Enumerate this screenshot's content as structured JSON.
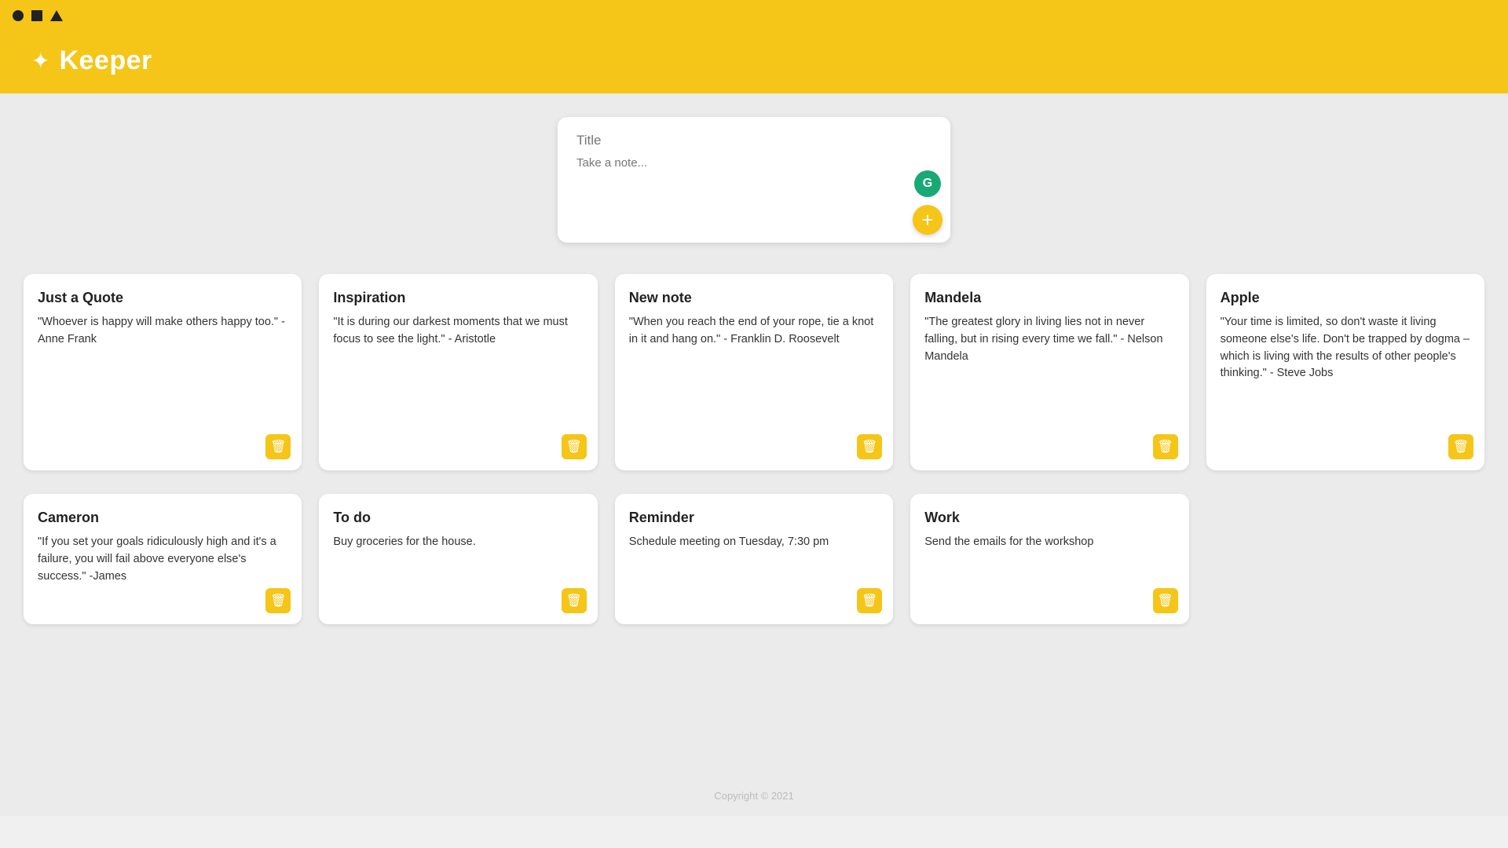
{
  "titlebar": {
    "shapes": [
      "circle",
      "square",
      "triangle"
    ]
  },
  "header": {
    "logo_symbol": "✦",
    "title": "Keeper"
  },
  "note_input": {
    "title_placeholder": "Title",
    "body_placeholder": "Take a note...",
    "grammarly_label": "G",
    "add_button_label": "+"
  },
  "notes_row1": [
    {
      "title": "Just a Quote",
      "body": "\"Whoever is happy will make others happy too.\" -Anne Frank"
    },
    {
      "title": "Inspiration",
      "body": "\"It is during our darkest moments that we must focus to see the light.\" - Aristotle"
    },
    {
      "title": "New note",
      "body": "\"When you reach the end of your rope, tie a knot in it and hang on.\" - Franklin D. Roosevelt"
    },
    {
      "title": "Mandela",
      "body": "\"The greatest glory in living lies not in never falling, but in rising every time we fall.\" - Nelson Mandela"
    },
    {
      "title": "Apple",
      "body": "\"Your time is limited, so don't waste it living someone else's life. Don't be trapped by dogma – which is living with the results of other people's thinking.\" - Steve Jobs"
    }
  ],
  "notes_row2": [
    {
      "title": "Cameron",
      "body": "\"If you set your goals ridiculously high and it's a failure, you will fail above everyone else's success.\" -James"
    },
    {
      "title": "To do",
      "body": "Buy groceries for the house."
    },
    {
      "title": "Reminder",
      "body": "Schedule meeting on Tuesday, 7:30 pm"
    },
    {
      "title": "Work",
      "body": "Send the emails for the workshop"
    },
    {
      "title": "",
      "body": ""
    }
  ],
  "footer": {
    "copyright": "Copyright © 2021"
  }
}
